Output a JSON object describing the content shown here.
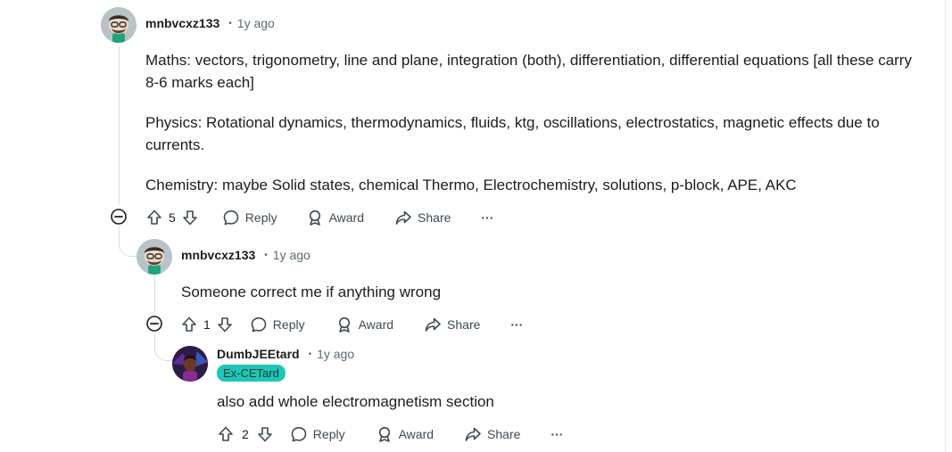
{
  "comments": [
    {
      "user": "mnbvcxz133",
      "separator": "•",
      "time": "1y ago",
      "paragraphs": [
        "Maths: vectors, trigonometry, line and plane, integration (both), differentiation, differential equations [all these carry 8-6 marks each]",
        "Physics: Rotational dynamics, thermodynamics, fluids, ktg, oscillations, electrostatics, magnetic effects due to currents.",
        "Chemistry: maybe Solid states, chemical Thermo, Electrochemistry, solutions, p-block, APE, AKC"
      ],
      "votes": "5"
    },
    {
      "user": "mnbvcxz133",
      "separator": "•",
      "time": "1y ago",
      "paragraphs": [
        "Someone correct me if anything wrong"
      ],
      "votes": "1"
    },
    {
      "user": "DumbJEEtard",
      "separator": "•",
      "time": "1y ago",
      "flair": "Ex-CETard",
      "paragraphs": [
        "also add whole electromagnetism section"
      ],
      "votes": "2"
    }
  ],
  "actions": {
    "reply": "Reply",
    "award": "Award",
    "share": "Share",
    "more": "···"
  },
  "colors": {
    "flair_bg": "#1dc6b6",
    "thread_line": "#d9dde0",
    "meta_text": "#5c6c74"
  }
}
